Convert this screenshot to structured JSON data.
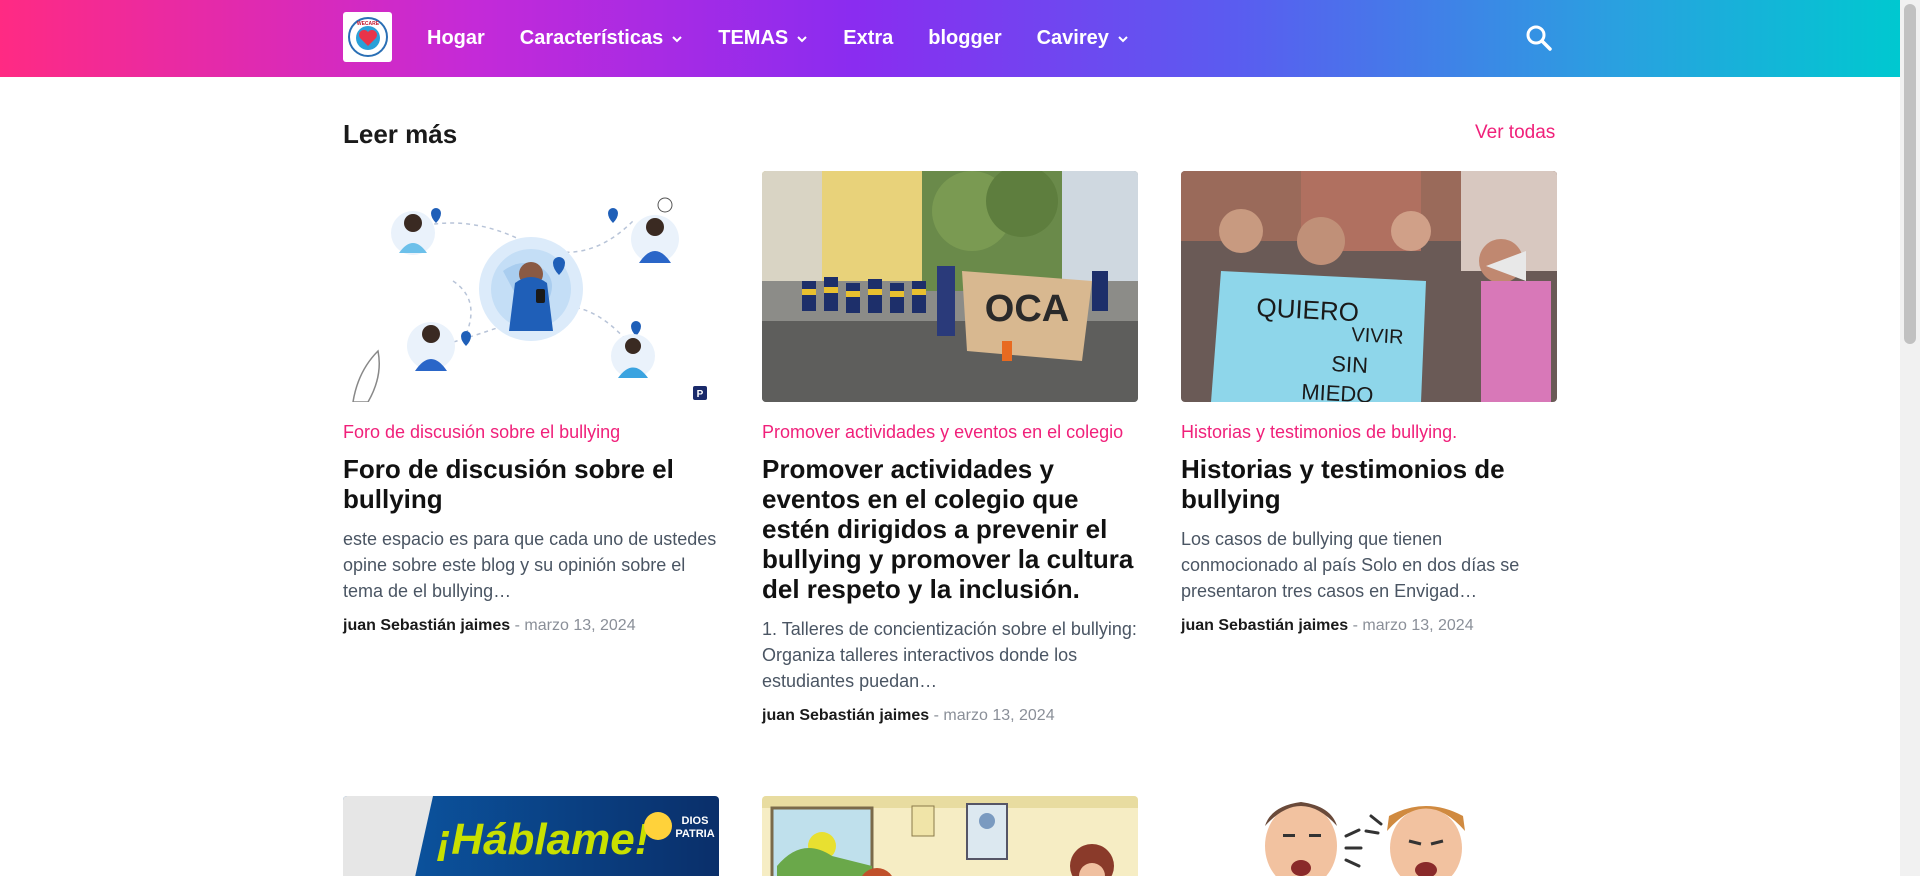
{
  "header": {
    "nav": [
      {
        "label": "Hogar",
        "dropdown": false
      },
      {
        "label": "Características",
        "dropdown": true
      },
      {
        "label": "TEMAS",
        "dropdown": true
      },
      {
        "label": "Extra",
        "dropdown": false
      },
      {
        "label": "blogger",
        "dropdown": false
      },
      {
        "label": "Cavirey",
        "dropdown": true
      }
    ],
    "gradient": [
      "#ff2a83",
      "#8a2cf0",
      "#00c8d0"
    ],
    "logo_text": "WECARE"
  },
  "section": {
    "title": "Leer más",
    "view_all": "Ver todas",
    "accent": "#f0207a"
  },
  "posts": [
    {
      "category": "Foro de discusión sobre el bullying",
      "title": "Foro de discusión sobre el bullying",
      "excerpt": "este espacio es para que cada uno de ustedes opine sobre este blog y su opinión sobre el tema de el bullying…",
      "author": "juan Sebastián jaimes",
      "separator": "-",
      "date": "marzo 13, 2024",
      "image": "illustration-people-globe"
    },
    {
      "category": "Promover actividades y eventos en el colegio",
      "title": "Promover actividades y eventos en el colegio que estén dirigidos a prevenir el bullying y promover la cultura del respeto y la inclusión.",
      "excerpt": "1. Talleres de concientización sobre el bullying: Organiza talleres interactivos donde los estudiantes puedan…",
      "author": "juan Sebastián jaimes",
      "separator": "-",
      "date": "marzo 13, 2024",
      "image": "photo-students-march"
    },
    {
      "category": "Historias y testimonios de bullying.",
      "title": "Historias y testimonios de bullying",
      "excerpt": "Los casos de bullying que tienen conmocionado al país Solo en dos días se presentaron tres casos en Envigad…",
      "author": "juan Sebastián jaimes",
      "separator": "-",
      "date": "marzo 13, 2024",
      "image": "photo-protest-sign"
    }
  ],
  "photo_sign_text": "QUIERO VIVIR SIN MIEDO",
  "next_row": [
    {
      "image": "hablame-banner",
      "text": "¡Háblame!",
      "badge": "DIOS PATRIA"
    },
    {
      "image": "classroom-cartoon"
    },
    {
      "image": "angry-cartoon-faces"
    }
  ]
}
